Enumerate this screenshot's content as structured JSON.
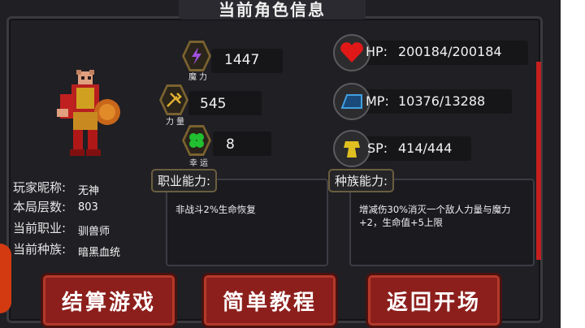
{
  "title": "当前角色信息",
  "stats_left": [
    {
      "icon": "magic-icon",
      "label": "魔力",
      "value": "1447"
    },
    {
      "icon": "strength-icon",
      "label": "力量",
      "value": "545"
    },
    {
      "icon": "luck-icon",
      "label": "幸运",
      "value": "8"
    }
  ],
  "stats_right": [
    {
      "icon": "heart-icon",
      "label": "HP:",
      "value": "200184/200184"
    },
    {
      "icon": "mana-icon",
      "label": "MP:",
      "value": "10376/13288"
    },
    {
      "icon": "stamina-icon",
      "label": "SP:",
      "value": "414/444"
    }
  ],
  "info": {
    "nickname_label": "玩家昵称:",
    "nickname": "无神",
    "floor_label": "本局层数:",
    "floor": "803",
    "job_label": "当前职业:",
    "job": "驯兽师",
    "race_label": "当前种族:",
    "race": "暗黑血统"
  },
  "job_ability": {
    "header": "职业能力:",
    "text": "非战斗2%生命恢复"
  },
  "race_ability": {
    "header": "种族能力:",
    "text": "增减伤30%消灭一个敌人力量与魔力+2，生命值+5上限"
  },
  "buttons": {
    "settle": "结算游戏",
    "tutorial": "简单教程",
    "back": "返回开场"
  },
  "colors": {
    "accent": "#8c1f1c",
    "panel": "#1f1f24"
  }
}
